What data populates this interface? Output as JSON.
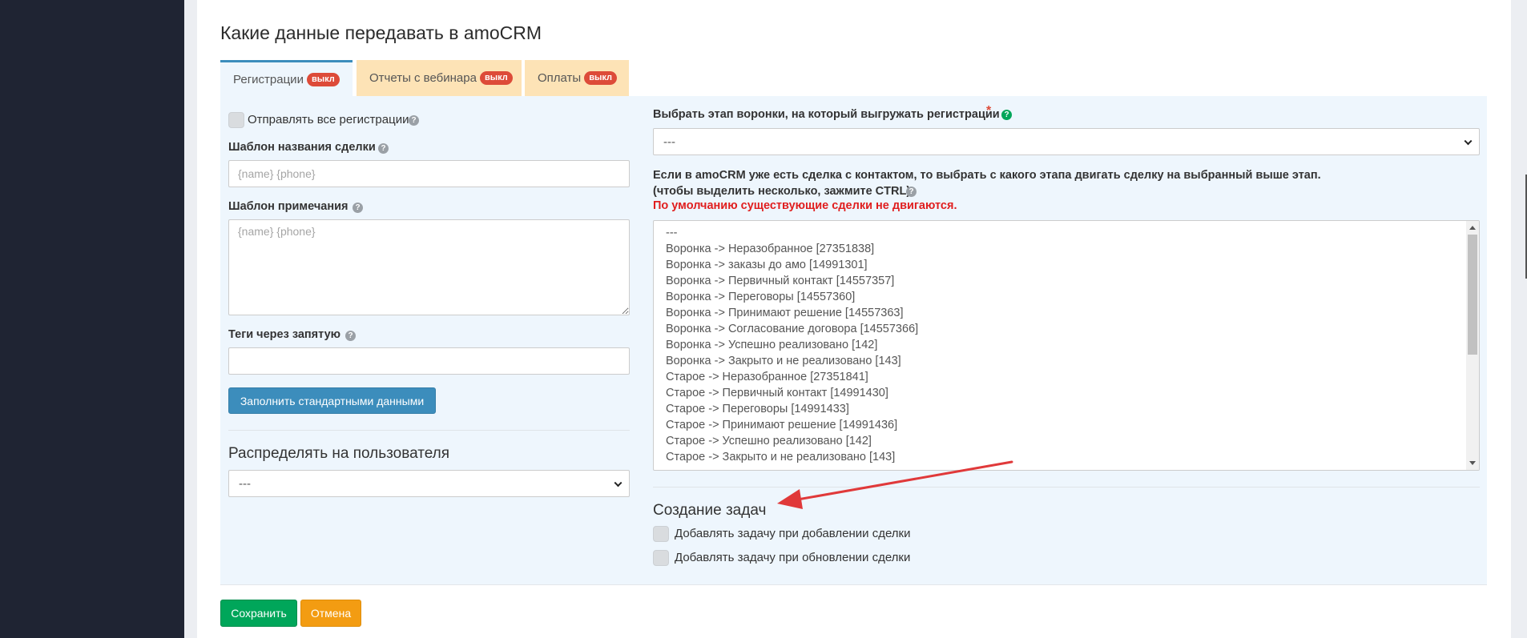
{
  "section_title": "Какие данные передавать в amoCRM",
  "tabs": [
    {
      "label": "Регистрации",
      "badge": "выкл",
      "active": true
    },
    {
      "label": "Отчеты с вебинара",
      "badge": "выкл",
      "active": false
    },
    {
      "label": "Оплаты",
      "badge": "выкл",
      "active": false
    }
  ],
  "left": {
    "send_all_label": "Отправлять все регистрации",
    "deal_template_label": "Шаблон названия сделки",
    "deal_template_placeholder": "{name} {phone}",
    "note_template_label": "Шаблон примечания",
    "note_template_placeholder": "{name} {phone}",
    "tags_label": "Теги через запятую",
    "tags_value": "",
    "fill_defaults_button": "Заполнить стандартными данными",
    "distribute_title": "Распределять на пользователя",
    "distribute_selected": "---"
  },
  "right": {
    "stage_label": "Выбрать этап воронки, на который выгружать регистрации",
    "required_mark": "*",
    "stage_selected": "---",
    "move_notice_line1": "Если в amoCRM уже есть сделка с контактом, то выбрать с какого этапа двигать сделку на выбранный выше этап.",
    "move_notice_line2": "(чтобы выделить несколько, зажмите CTRL)",
    "move_notice_red": "По умолчанию существующие сделки не двигаются.",
    "stages_list": [
      "---",
      "Воронка -> Неразобранное [27351838]",
      "Воронка -> заказы до амо [14991301]",
      "Воронка -> Первичный контакт [14557357]",
      "Воронка -> Переговоры [14557360]",
      "Воронка -> Принимают решение [14557363]",
      "Воронка -> Согласование договора [14557366]",
      "Воронка -> Успешно реализовано [142]",
      "Воронка -> Закрыто и не реализовано [143]",
      "Старое -> Неразобранное [27351841]",
      "Старое -> Первичный контакт [14991430]",
      "Старое -> Переговоры [14991433]",
      "Старое -> Принимают решение [14991436]",
      "Старое -> Успешно реализовано [142]",
      "Старое -> Закрыто и не реализовано [143]"
    ],
    "tasks_title": "Создание задач",
    "task_on_add_label": "Добавлять задачу при добавлении сделки",
    "task_on_update_label": "Добавлять задачу при обновлении сделки"
  },
  "footer": {
    "save_button": "Сохранить",
    "cancel_button": "Отмена"
  },
  "colors": {
    "sidebar": "#1f2433",
    "tab_active_border": "#3c8dbc",
    "tab_inactive_bg": "#fde3b6",
    "badge": "#dd4b39",
    "content_bg": "#eef6fd",
    "save": "#00a65a",
    "cancel": "#f39c12",
    "arrow": "#e0393a"
  },
  "icons": {
    "help": "question-circle-icon",
    "select": "chevron-down-icon",
    "annotation": "red-arrow-icon"
  }
}
